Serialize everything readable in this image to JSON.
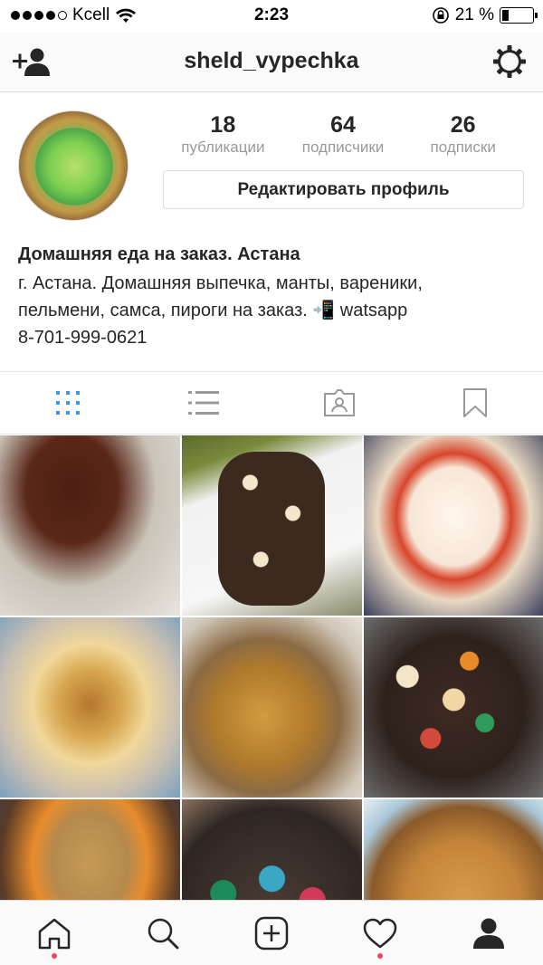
{
  "status_bar": {
    "carrier": "Kcell",
    "time": "2:23",
    "battery_percent": "21 %",
    "battery_level": 0.21
  },
  "header": {
    "username": "sheld_vypechka",
    "add_user_icon": "add-person-icon",
    "settings_icon": "gear-icon"
  },
  "profile": {
    "stats": [
      {
        "count": "18",
        "label": "публикации"
      },
      {
        "count": "64",
        "label": "подписчики"
      },
      {
        "count": "26",
        "label": "подписки"
      }
    ],
    "edit_button_label": "Редактировать профиль",
    "name": "Домашняя еда на заказ. Астана",
    "bio_line1": "г. Астана. Домашняя выпечка, манты, вареники,",
    "bio_line2": "пельмени, самса, пироги на заказ. 📲 watsapp",
    "phone": "8-701-999-0621"
  },
  "tabs": [
    {
      "name": "grid-view-icon",
      "active": true
    },
    {
      "name": "list-view-icon",
      "active": false
    },
    {
      "name": "tagged-icon",
      "active": false
    },
    {
      "name": "saved-icon",
      "active": false
    }
  ],
  "colors": {
    "active_tab": "#3897f0",
    "inactive_icon": "#999999",
    "notification_dot": "#ed4956"
  },
  "posts": [
    "cupcakes on tiered stand",
    "chocolate cookies with cream",
    "red velvet cake",
    "almond cake",
    "baked pie",
    "decorated gingerbread cookies",
    "cake with mandarin slices",
    "christmas gingerbread cookies",
    "lattice pie"
  ],
  "bottom_nav": [
    {
      "name": "home-icon",
      "dot": true
    },
    {
      "name": "search-icon",
      "dot": false
    },
    {
      "name": "new-post-icon",
      "dot": false
    },
    {
      "name": "activity-heart-icon",
      "dot": true
    },
    {
      "name": "profile-icon",
      "dot": false
    }
  ]
}
